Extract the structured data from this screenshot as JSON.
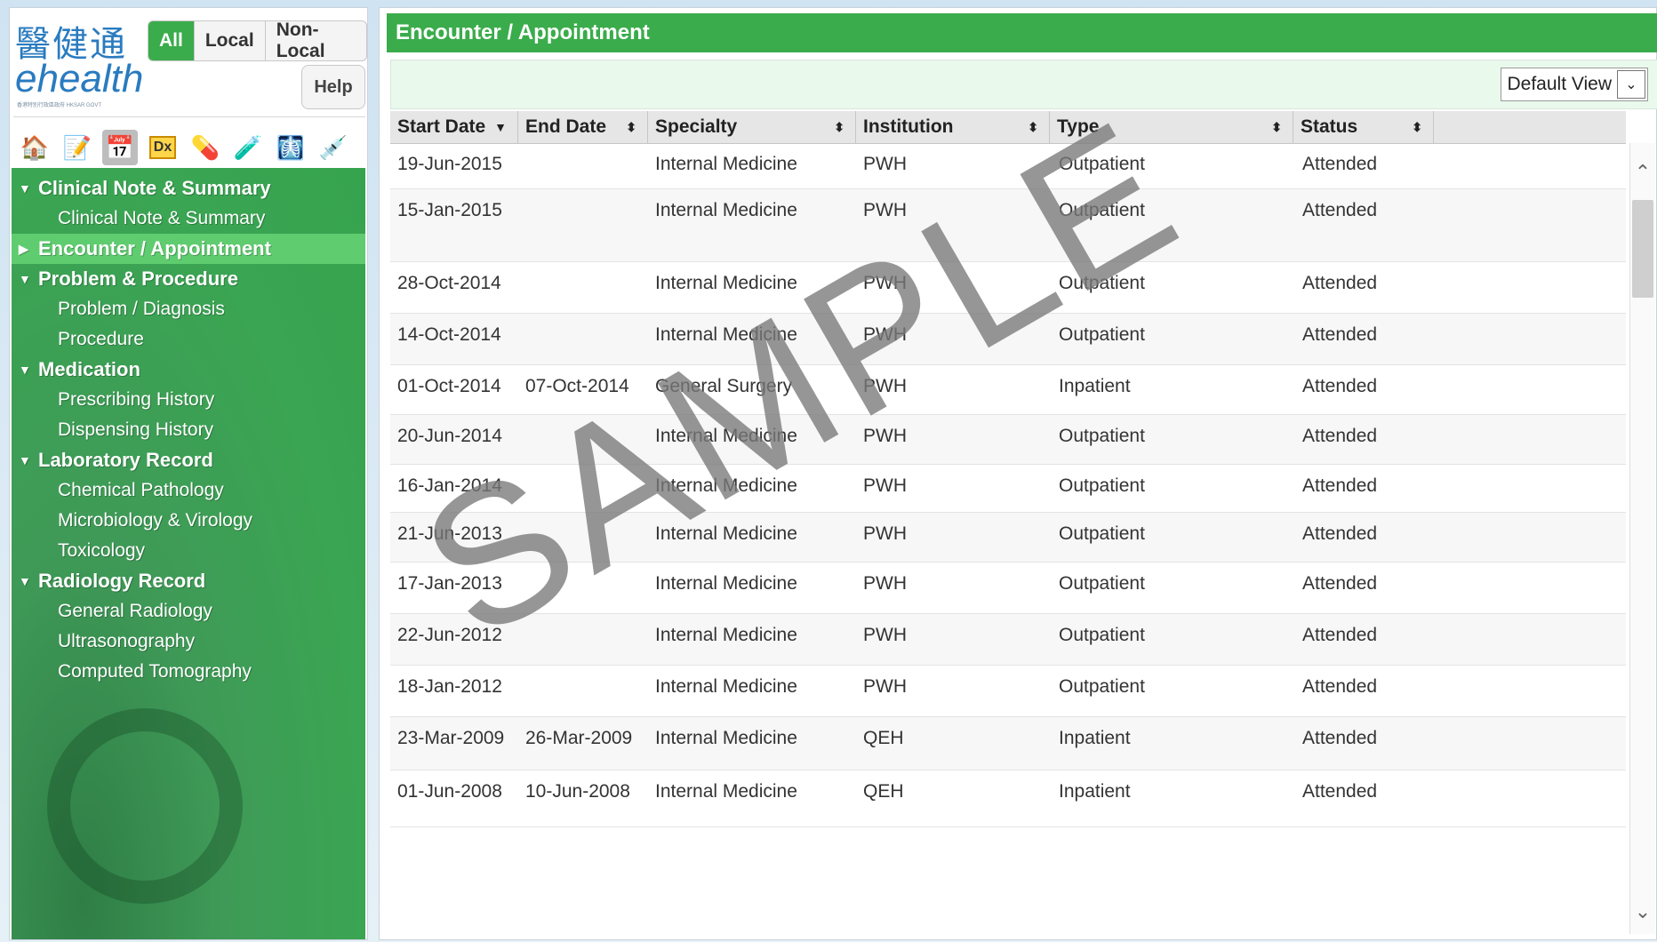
{
  "brand": {
    "logo_chinese": "醫健通",
    "logo_english": "ehealth",
    "logo_subtitle": "香港特別行政區政府 HKSAR GOVT"
  },
  "scope_tabs": [
    {
      "label": "All",
      "active": true
    },
    {
      "label": "Local",
      "active": false
    },
    {
      "label": "Non-Local",
      "active": false
    }
  ],
  "help_label": "Help",
  "toolbar_icons": [
    "home-icon",
    "notepad-icon",
    "calendar-icon",
    "dx-folder-icon",
    "prescription-icon",
    "lab-flask-icon",
    "radiology-icon",
    "syringe-icon"
  ],
  "nav": [
    {
      "type": "group",
      "label": "Clinical Note & Summary",
      "expanded": true
    },
    {
      "type": "item",
      "label": "Clinical Note & Summary"
    },
    {
      "type": "group",
      "label": "Encounter / Appointment",
      "expanded": false,
      "selected": true
    },
    {
      "type": "group",
      "label": "Problem & Procedure",
      "expanded": true
    },
    {
      "type": "item",
      "label": "Problem / Diagnosis"
    },
    {
      "type": "item",
      "label": "Procedure"
    },
    {
      "type": "group",
      "label": "Medication",
      "expanded": true
    },
    {
      "type": "item",
      "label": "Prescribing History"
    },
    {
      "type": "item",
      "label": "Dispensing History"
    },
    {
      "type": "group",
      "label": "Laboratory Record",
      "expanded": true
    },
    {
      "type": "item",
      "label": "Chemical Pathology"
    },
    {
      "type": "item",
      "label": "Microbiology & Virology"
    },
    {
      "type": "item",
      "label": "Toxicology"
    },
    {
      "type": "group",
      "label": "Radiology Record",
      "expanded": true
    },
    {
      "type": "item",
      "label": "General Radiology"
    },
    {
      "type": "item",
      "label": "Ultrasonography"
    },
    {
      "type": "item",
      "label": "Computed Tomography"
    }
  ],
  "main": {
    "title": "Encounter / Appointment",
    "view_select": "Default View",
    "columns": [
      {
        "label": "Start Date",
        "sort": "▼"
      },
      {
        "label": "End Date",
        "sort": "⬍"
      },
      {
        "label": "Specialty",
        "sort": "⬍"
      },
      {
        "label": "Institution",
        "sort": "⬍"
      },
      {
        "label": "Type",
        "sort": "⬍"
      },
      {
        "label": "Status",
        "sort": "⬍"
      }
    ],
    "rows": [
      [
        "19-Jun-2015",
        "",
        "Internal Medicine",
        "PWH",
        "Outpatient",
        "Attended"
      ],
      [
        "15-Jan-2015",
        "",
        "Internal Medicine",
        "PWH",
        "Outpatient",
        "Attended"
      ],
      [
        "28-Oct-2014",
        "",
        "Internal Medicine",
        "PWH",
        "Outpatient",
        "Attended"
      ],
      [
        "14-Oct-2014",
        "",
        "Internal Medicine",
        "PWH",
        "Outpatient",
        "Attended"
      ],
      [
        "01-Oct-2014",
        "07-Oct-2014",
        "General Surgery",
        "PWH",
        "Inpatient",
        "Attended"
      ],
      [
        "20-Jun-2014",
        "",
        "Internal Medicine",
        "PWH",
        "Outpatient",
        "Attended"
      ],
      [
        "16-Jan-2014",
        "",
        "Internal Medicine",
        "PWH",
        "Outpatient",
        "Attended"
      ],
      [
        "21-Jun-2013",
        "",
        "Internal Medicine",
        "PWH",
        "Outpatient",
        "Attended"
      ],
      [
        "17-Jan-2013",
        "",
        "Internal Medicine",
        "PWH",
        "Outpatient",
        "Attended"
      ],
      [
        "22-Jun-2012",
        "",
        "Internal Medicine",
        "PWH",
        "Outpatient",
        "Attended"
      ],
      [
        "18-Jan-2012",
        "",
        "Internal Medicine",
        "PWH",
        "Outpatient",
        "Attended"
      ],
      [
        "23-Mar-2009",
        "26-Mar-2009",
        "Internal Medicine",
        "QEH",
        "Inpatient",
        "Attended"
      ],
      [
        "01-Jun-2008",
        "10-Jun-2008",
        "Internal Medicine",
        "QEH",
        "Inpatient",
        "Attended"
      ]
    ]
  },
  "watermark": "SAMPLE",
  "colors": {
    "accent_green": "#3aac4b",
    "selected_green": "#5fcc6f"
  }
}
